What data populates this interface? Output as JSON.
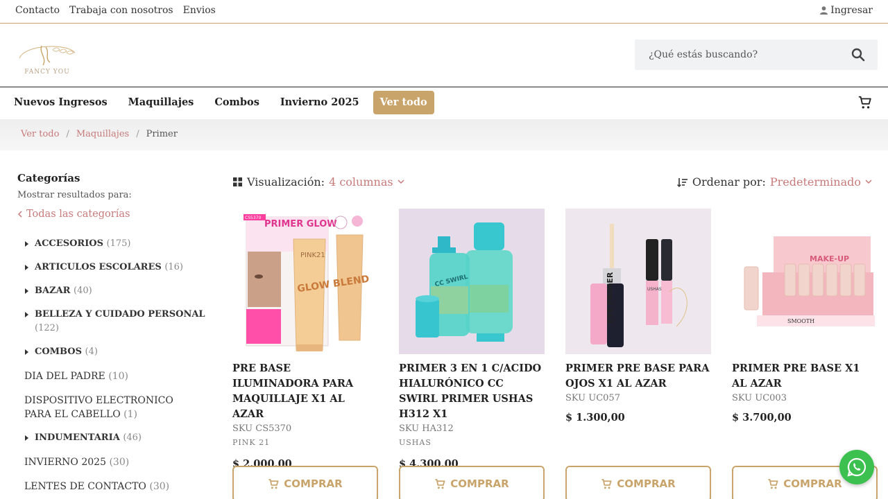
{
  "topbar": {
    "links": [
      "Contacto",
      "Trabaja con nosotros",
      "Envios"
    ],
    "login_label": "Ingresar"
  },
  "header": {
    "logo_text": "FANCY YOU",
    "search_placeholder": "¿Qué estás buscando?"
  },
  "nav": {
    "items": [
      "Nuevos Ingresos",
      "Maquillajes",
      "Combos",
      "Invierno 2025"
    ],
    "cta_label": "Ver todo"
  },
  "breadcrumb": {
    "items": [
      "Ver todo",
      "Maquillajes"
    ],
    "current": "Primer",
    "separator": "/"
  },
  "sidebar": {
    "title": "Categorías",
    "subtitle": "Mostrar resultados para:",
    "all_label": "Todas las categorías",
    "categories": [
      {
        "name": "ACCESORIOS",
        "count": "(175)",
        "expandable": true
      },
      {
        "name": "ARTICULOS ESCOLARES",
        "count": "(16)",
        "expandable": true
      },
      {
        "name": "BAZAR",
        "count": "(40)",
        "expandable": true
      },
      {
        "name": "BELLEZA Y CUIDADO PERSONAL",
        "count": "(122)",
        "expandable": true
      },
      {
        "name": "COMBOS",
        "count": "(4)",
        "expandable": true
      },
      {
        "name": "DIA DEL PADRE",
        "count": "(10)",
        "expandable": false
      },
      {
        "name": "DISPOSITIVO ELECTRONICO PARA EL CABELLO",
        "count": "(1)",
        "expandable": false
      },
      {
        "name": "INDUMENTARIA",
        "count": "(46)",
        "expandable": true
      },
      {
        "name": "INVIERNO 2025",
        "count": "(30)",
        "expandable": false
      },
      {
        "name": "LENTES DE CONTACTO",
        "count": "(30)",
        "expandable": false
      }
    ]
  },
  "toolbar": {
    "viz_label": "Visualización:",
    "viz_value": "4 columnas",
    "order_label": "Ordenar por:",
    "order_value": "Predeterminado"
  },
  "products": [
    {
      "name": "PRE BASE ILUMINADORA PARA MAQUILLAJE X1 AL AZAR",
      "sku": "SKU CS5370",
      "brand": "PINK 21",
      "price": "$  2.000,00",
      "buy_label": "COMPRAR"
    },
    {
      "name": "PRIMER 3 EN 1 C/ACIDO HIALURÓNICO CC SWIRL PRIMER USHAS H312 X1",
      "sku": "SKU HA312",
      "brand": "USHAS",
      "price": "$  4.300,00",
      "buy_label": "COMPRAR"
    },
    {
      "name": "PRIMER PRE BASE PARA OJOS X1 AL AZAR",
      "sku": "SKU UC057",
      "brand": "",
      "price": "$  1.300,00",
      "buy_label": "COMPRAR"
    },
    {
      "name": "PRIMER PRE BASE X1 AL AZAR",
      "sku": "SKU UC003",
      "brand": "",
      "price": "$  3.700,00",
      "buy_label": "COMPRAR"
    }
  ],
  "product_image_text": {
    "p1_title": "PRIMER GLOW",
    "p1_code": "CS5370",
    "p1_tube": "GLOW BLEND",
    "p1_brand": "PINK21",
    "p2_label": "CC SWIRL",
    "p3_label": "EYE PRIMER",
    "p3_brand": "USHAS",
    "p4_label": "MAKE-UP",
    "p4_brand": "SMOOTH"
  },
  "colors": {
    "accent_gold": "#c9a46a",
    "link_rose": "#c77a7a",
    "whatsapp_green": "#3cc04f"
  }
}
